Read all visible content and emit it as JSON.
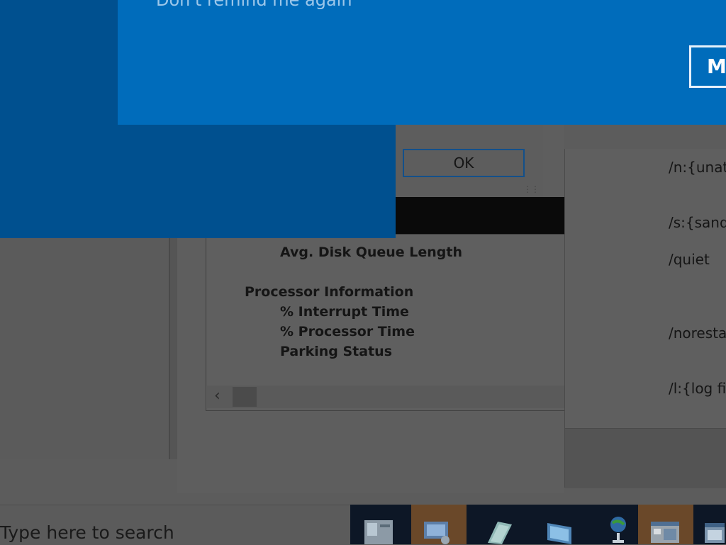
{
  "banner": {
    "remind_text": "Don't remind me again",
    "button_label": "M"
  },
  "dialog": {
    "ok_label": "OK"
  },
  "perf_counters": {
    "disk_counter": "Avg. Disk Queue Length",
    "group": "Processor Information",
    "items": [
      "% Interrupt Time",
      "% Processor Time",
      "Parking Status"
    ]
  },
  "command_options": [
    "/n:{unat",
    "/s:{sand",
    "/quiet",
    "/noresta",
    "/l:{log fi"
  ],
  "taskbar": {
    "search_placeholder": "Type here to search",
    "icons": [
      "server-manager-icon",
      "remote-desktop-icon",
      "notepad-icon",
      "monitor-icon",
      "network-globe-icon",
      "control-panel-icon",
      "window-icon"
    ]
  },
  "colors": {
    "banner_blue": "#006cbb",
    "overlay_blue": "#00508f",
    "taskbar_dark": "#0d1726",
    "taskbar_active": "#6a4829"
  }
}
